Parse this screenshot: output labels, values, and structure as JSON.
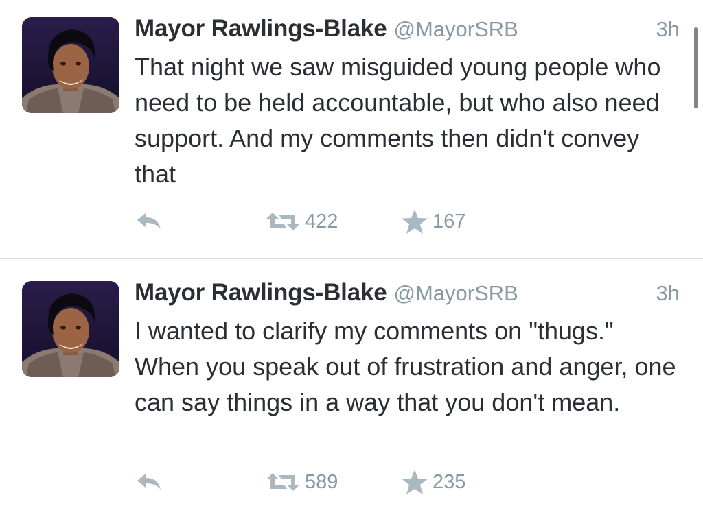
{
  "tweets": [
    {
      "author_name": "Mayor Rawlings-Blake",
      "author_handle": "@MayorSRB",
      "time": "3h",
      "text": "That night we saw misguided young people who need to be held accountable, but who also need support. And my comments then didn't convey that",
      "retweets": "422",
      "favorites": "167"
    },
    {
      "author_name": "Mayor Rawlings-Blake",
      "author_handle": "@MayorSRB",
      "time": "3h",
      "text": "I wanted to clarify my comments on \"thugs.\" When you speak out of frustration and anger, one can say things in a way that you don't mean.",
      "retweets": "589",
      "favorites": "235"
    }
  ],
  "icons": {
    "reply": "reply-icon",
    "retweet": "retweet-icon",
    "favorite": "star-icon"
  },
  "colors": {
    "text": "#292f33",
    "secondary": "#8899a6",
    "icon": "#aab8c2",
    "divider": "#d8dde1"
  }
}
